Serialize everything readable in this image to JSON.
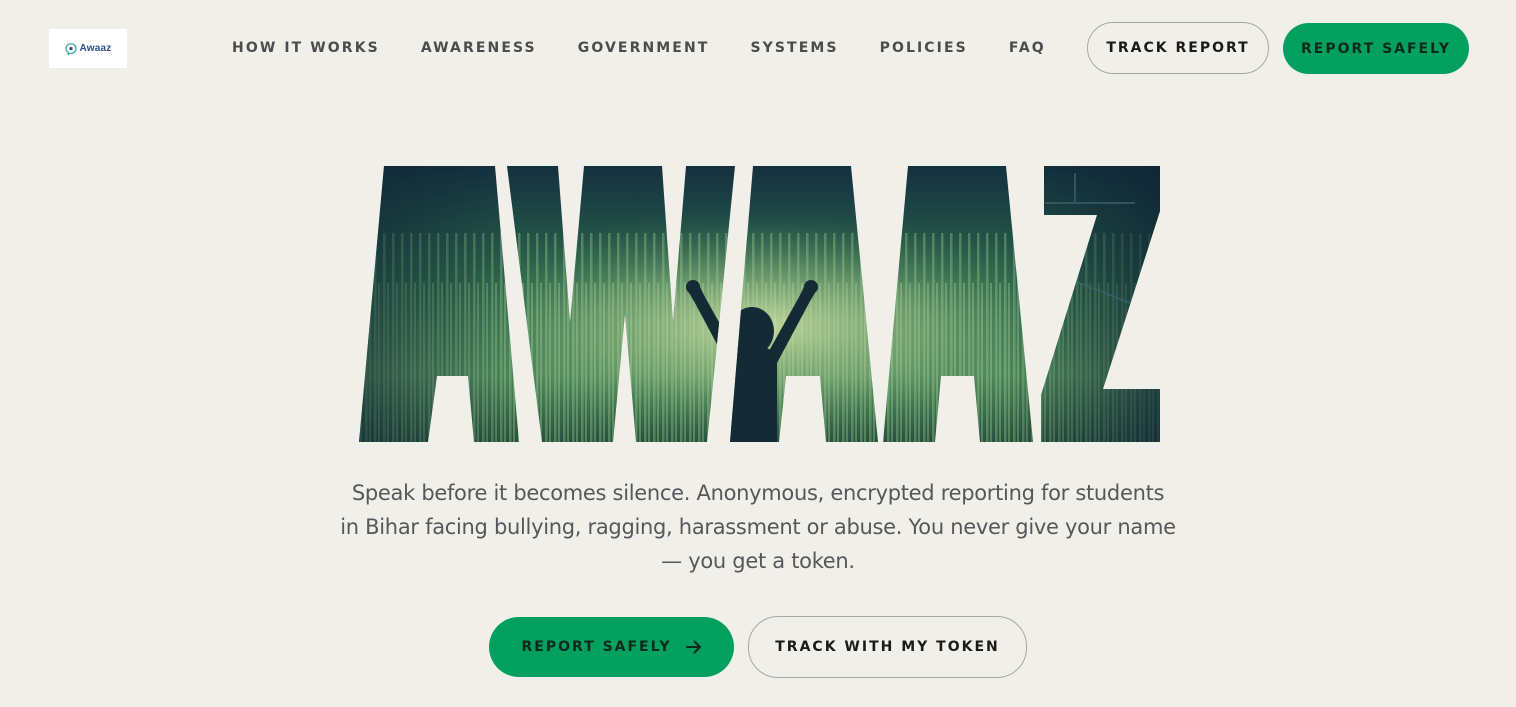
{
  "header": {
    "logo_text": "Awaaz",
    "logo_icon": "shield-chat-icon",
    "nav": [
      "HOW IT WORKS",
      "AWARENESS",
      "GOVERNMENT",
      "SYSTEMS",
      "POLICIES",
      "FAQ"
    ],
    "track_report_label": "TRACK REPORT",
    "report_safely_label": "REPORT SAFELY"
  },
  "hero": {
    "wordmark": "AWAAZ",
    "tagline": "Speak before it becomes silence. Anonymous, encrypted reporting for students in Bihar facing bullying, ragging, harassment or abuse. You never give your name — you get a token.",
    "primary_cta_label": "REPORT SAFELY",
    "primary_cta_icon": "arrow-right-icon",
    "secondary_cta_label": "TRACK WITH MY TOKEN"
  },
  "colors": {
    "background": "#f0efea",
    "accent_green": "#04a060",
    "nav_text": "#4a4c4e",
    "tagline_text": "#55575a"
  }
}
